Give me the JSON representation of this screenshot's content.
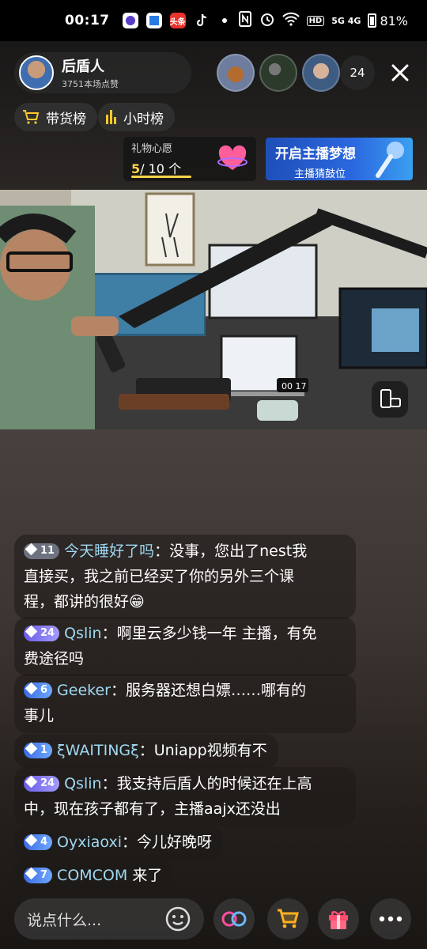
{
  "status_bar": {
    "time": "00:17",
    "signals": "5G 4G",
    "battery": "81%",
    "app_icons": [
      "app-icon",
      "app-icon",
      "toutiao-icon",
      "tiktok-icon"
    ],
    "toutiao_text": "头条"
  },
  "host": {
    "name": "后盾人",
    "likes": "3751本场点赞"
  },
  "viewer_count": "24",
  "pills": {
    "shop_rank": "带货榜",
    "hour_rank": "小时榜"
  },
  "wish": {
    "label": "礼物心愿",
    "current": "5",
    "total": "/ 10 个"
  },
  "banner": {
    "title": "开启主播梦想",
    "subtitle": "主播猜鼓位"
  },
  "video_clock": "00 17",
  "chat": [
    {
      "level": "11",
      "badge": "gray",
      "user": "今天睡好了吗",
      "lines": [
        "：没事，您出了nest我",
        "直接买，我之前已经买了你的另外三个课",
        "程，都讲的很好😁"
      ]
    },
    {
      "level": "24",
      "badge": "purple",
      "user": "Qslin",
      "lines": [
        "：啊里云多少钱一年 主播，有免",
        "费途径吗"
      ]
    },
    {
      "level": "6",
      "badge": "blue",
      "user": "Geeker",
      "lines": [
        "：服务器还想白嫖……哪有的",
        "事儿"
      ]
    },
    {
      "level": "1",
      "badge": "blue",
      "user": "ξWAITINGξ",
      "lines": [
        "：Uniapp视频有不"
      ]
    },
    {
      "level": "24",
      "badge": "purple",
      "user": "Qslin",
      "lines": [
        "：我支持后盾人的时候还在上高",
        "中，现在孩子都有了，主播aajx还没出"
      ]
    },
    {
      "level": "4",
      "badge": "blue",
      "user": "Oyxiaoxi",
      "lines": [
        "：今儿好晚呀"
      ]
    },
    {
      "level": "7",
      "badge": "blue",
      "user": "COMCOM",
      "lines": [
        " 来了"
      ]
    }
  ],
  "input": {
    "placeholder": "说点什么..."
  }
}
